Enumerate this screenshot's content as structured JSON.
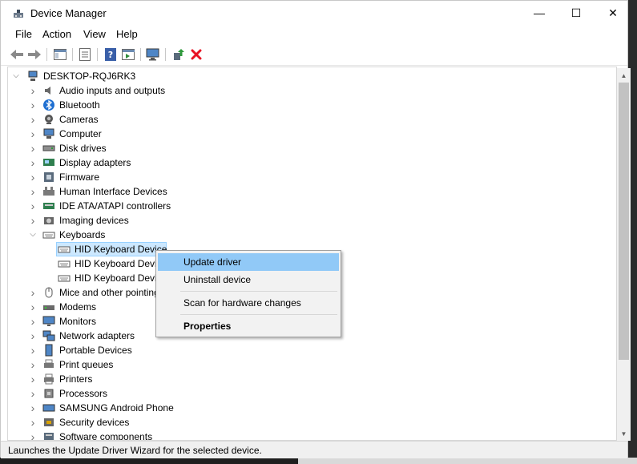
{
  "window": {
    "title": "Device Manager",
    "minimize_glyph": "—",
    "maximize_glyph": "☐",
    "close_glyph": "✕"
  },
  "menu": [
    "File",
    "Action",
    "View",
    "Help"
  ],
  "tree": {
    "root": "DESKTOP-RQJ6RK3",
    "categories": [
      {
        "label": "Audio inputs and outputs",
        "icon": "speaker-icon"
      },
      {
        "label": "Bluetooth",
        "icon": "bluetooth-icon"
      },
      {
        "label": "Cameras",
        "icon": "camera-icon"
      },
      {
        "label": "Computer",
        "icon": "computer-icon"
      },
      {
        "label": "Disk drives",
        "icon": "disk-drive-icon"
      },
      {
        "label": "Display adapters",
        "icon": "display-adapter-icon"
      },
      {
        "label": "Firmware",
        "icon": "firmware-icon"
      },
      {
        "label": "Human Interface Devices",
        "icon": "hid-icon"
      },
      {
        "label": "IDE ATA/ATAPI controllers",
        "icon": "ide-controller-icon"
      },
      {
        "label": "Imaging devices",
        "icon": "imaging-icon"
      },
      {
        "label": "Keyboards",
        "icon": "keyboard-icon",
        "expanded": true,
        "children": [
          "HID Keyboard Device",
          "HID Keyboard Device",
          "HID Keyboard Device"
        ]
      },
      {
        "label": "Mice and other pointing devices",
        "icon": "mouse-icon"
      },
      {
        "label": "Modems",
        "icon": "modem-icon"
      },
      {
        "label": "Monitors",
        "icon": "monitor-icon"
      },
      {
        "label": "Network adapters",
        "icon": "network-adapter-icon"
      },
      {
        "label": "Portable Devices",
        "icon": "portable-device-icon"
      },
      {
        "label": "Print queues",
        "icon": "print-queue-icon"
      },
      {
        "label": "Printers",
        "icon": "printer-icon"
      },
      {
        "label": "Processors",
        "icon": "processor-icon"
      },
      {
        "label": "SAMSUNG Android Phone",
        "icon": "phone-icon"
      },
      {
        "label": "Security devices",
        "icon": "security-device-icon"
      },
      {
        "label": "Software components",
        "icon": "software-component-icon"
      }
    ]
  },
  "context_menu": {
    "items": [
      {
        "label": "Update driver",
        "highlighted": true
      },
      {
        "label": "Uninstall device"
      },
      {
        "label": "Scan for hardware changes"
      },
      {
        "label": "Properties",
        "bold": true
      }
    ]
  },
  "status": "Launches the Update Driver Wizard for the selected device.",
  "colors": {
    "selection": "#cce8ff",
    "menu_highlight": "#91c9f7",
    "remove_red": "#e81123"
  }
}
